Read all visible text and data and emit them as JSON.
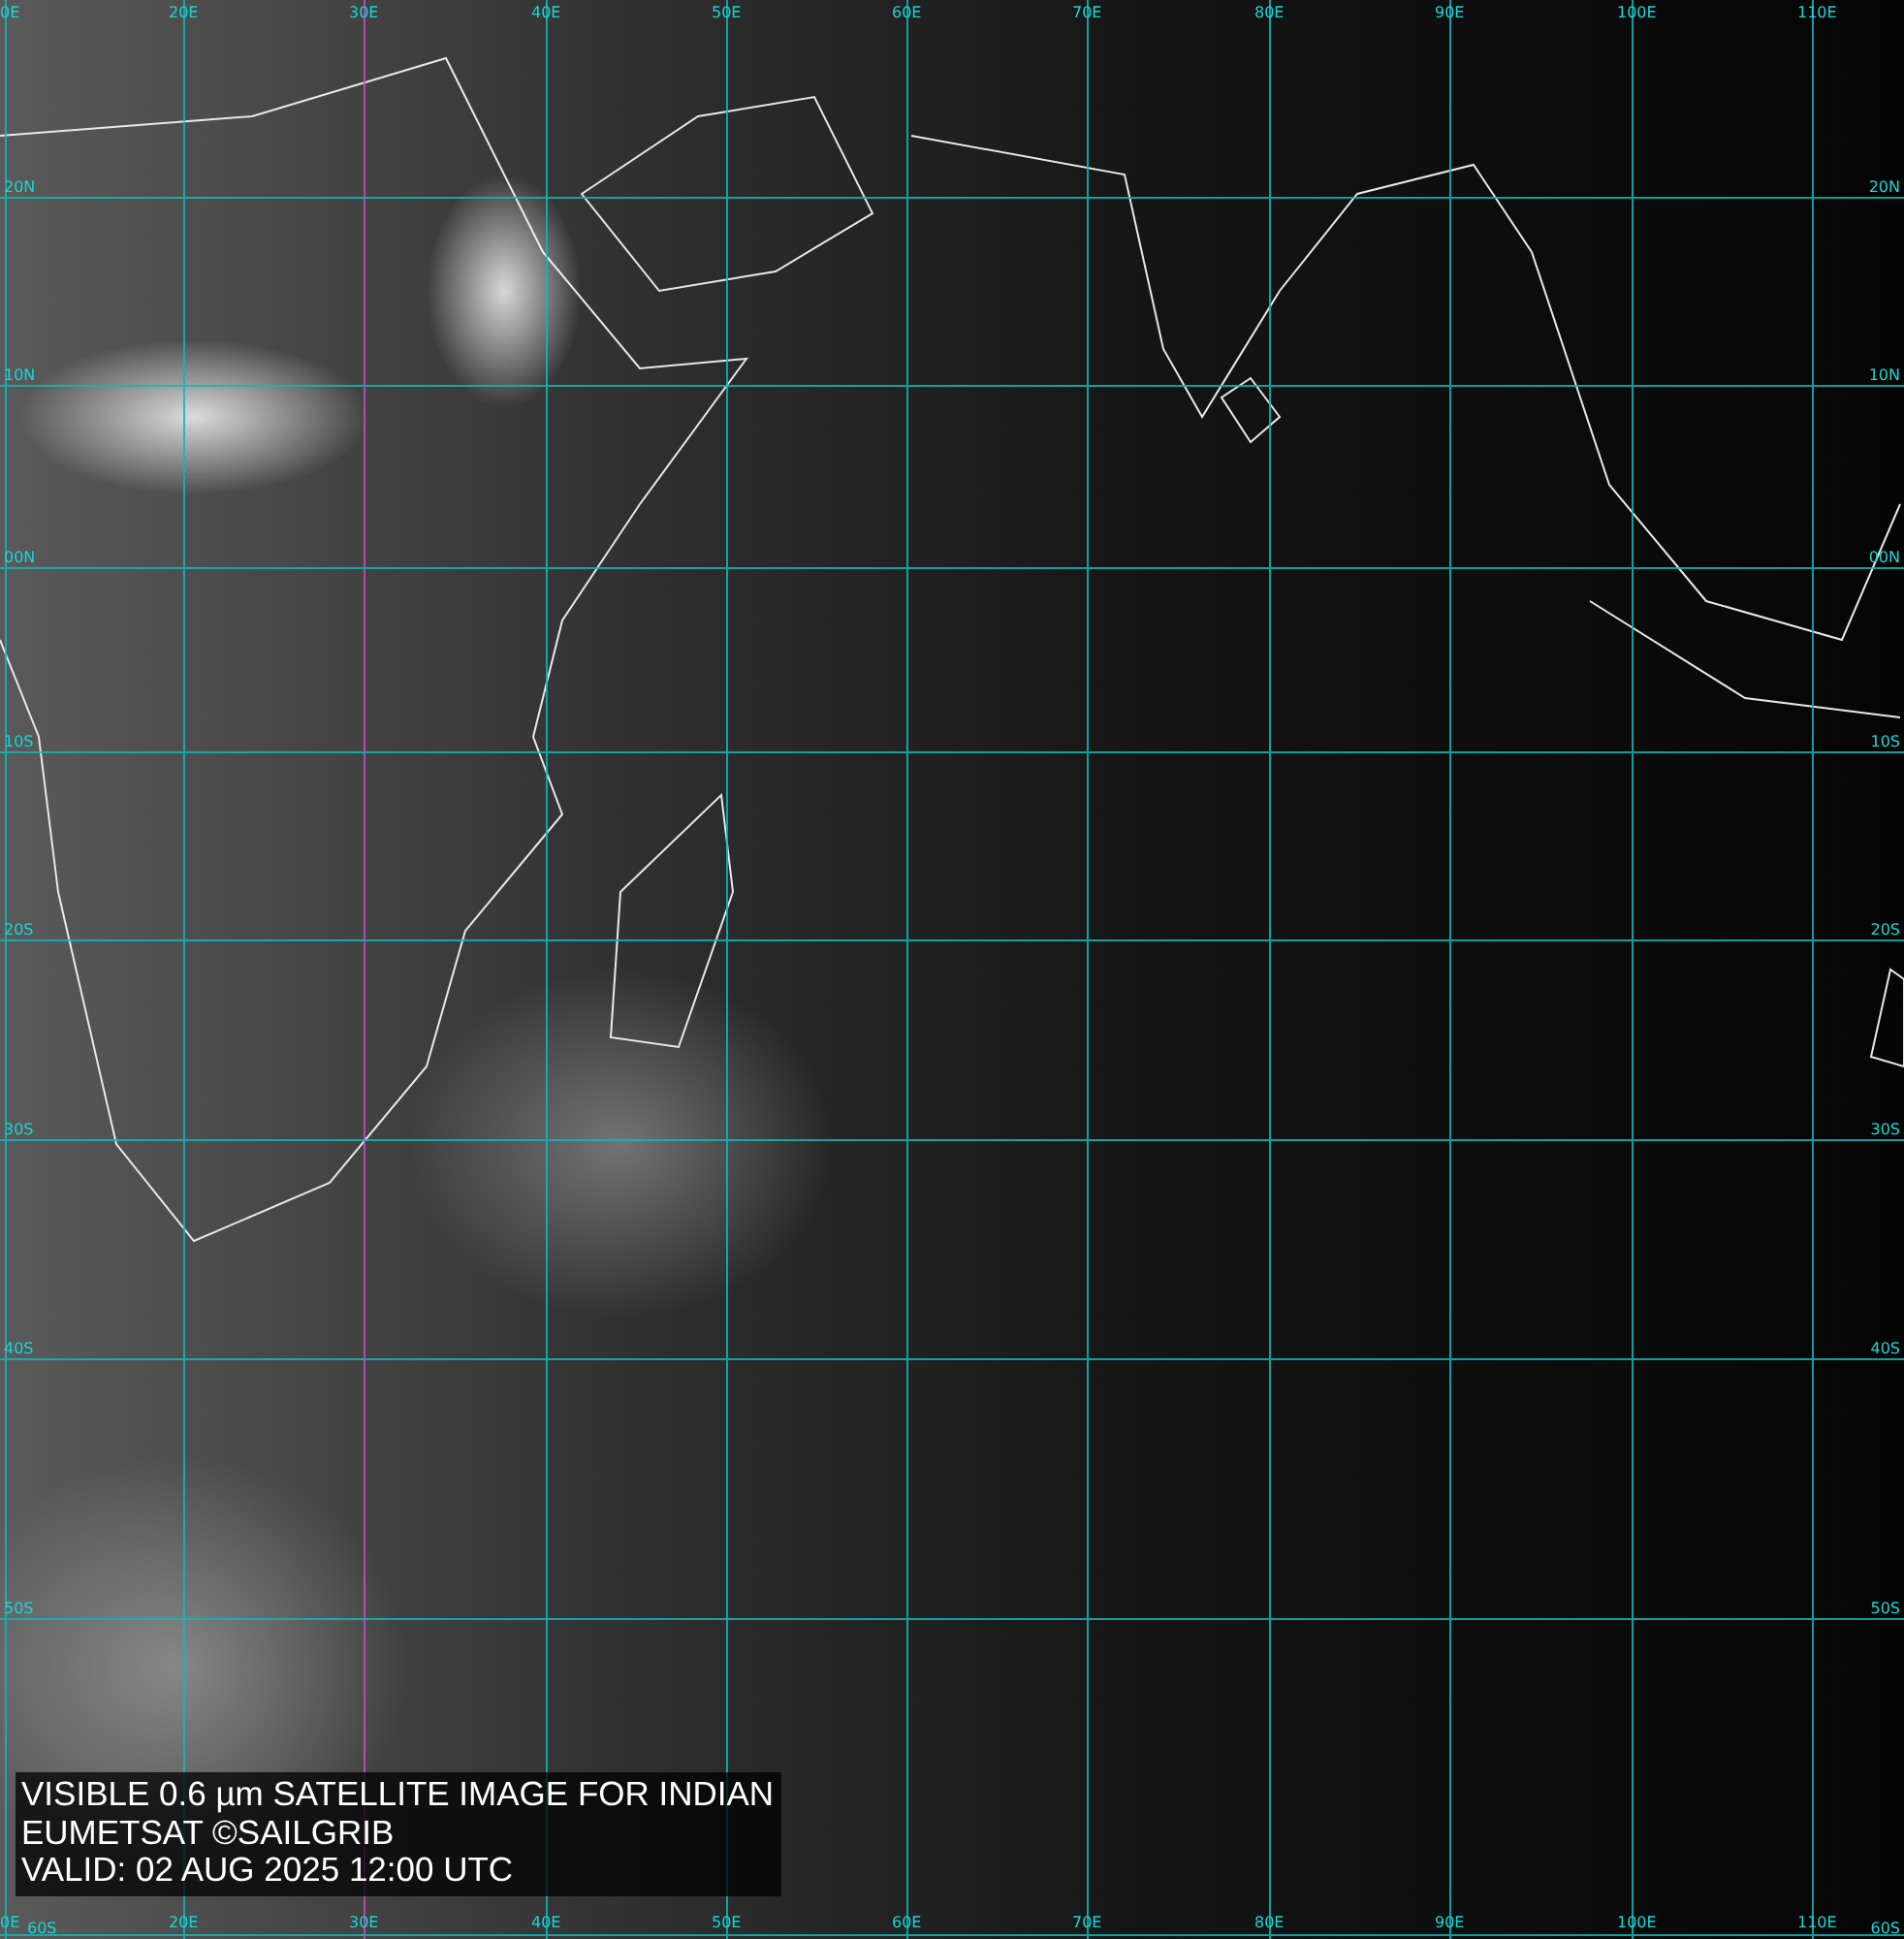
{
  "satellite_map": {
    "top_scale": [
      "0E",
      "20E",
      "30E",
      "40E",
      "50E",
      "60E",
      "70E",
      "80E",
      "90E",
      "100E",
      "110E"
    ],
    "bottom_scale": [
      "0E",
      "20E",
      "30E",
      "40E",
      "50E",
      "60E",
      "70E",
      "80E",
      "90E",
      "100E",
      "110E"
    ],
    "left_scale": [
      "20N",
      "10N",
      "00N",
      "10S",
      "20S",
      "30S",
      "40S",
      "50S",
      "60S"
    ],
    "right_scale": [
      "20N",
      "10N",
      "00N",
      "10S",
      "20S",
      "30S",
      "40S",
      "50S",
      "60S"
    ],
    "caption": [
      "VISIBLE 0.6 µm SATELLITE IMAGE FOR INDIAN",
      "EUMETSAT ©SAILGRIB",
      "VALID:  02 AUG 2025 12:00 UTC"
    ]
  }
}
